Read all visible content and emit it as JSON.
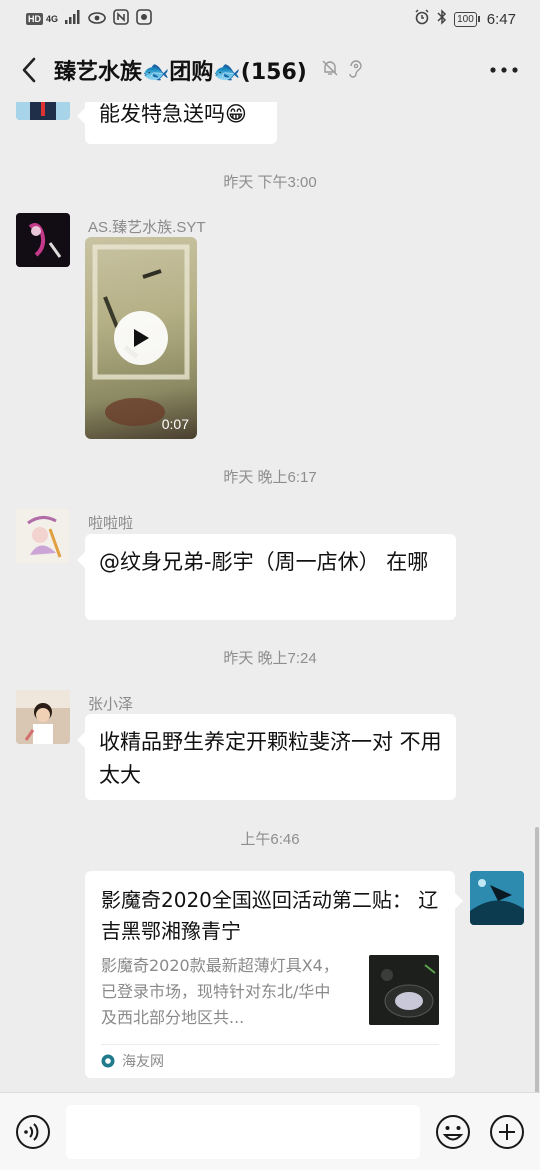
{
  "status_bar": {
    "signal_label": "HD",
    "network": "4G",
    "battery": "100",
    "time": "6:47"
  },
  "header": {
    "title": "臻艺水族🐟团购🐟(156)",
    "back_icon": "chevron-left-icon",
    "more_icon": "more-dots-icon"
  },
  "messages": [
    {
      "type": "text",
      "side": "left",
      "text": "能发特急送吗😁"
    },
    {
      "type": "timestamp",
      "text": "昨天 下午3:00"
    },
    {
      "type": "video",
      "side": "left",
      "sender": "AS.臻艺水族.SYT",
      "duration": "0:07"
    },
    {
      "type": "timestamp",
      "text": "昨天 晚上6:17"
    },
    {
      "type": "text",
      "side": "left",
      "sender": "啦啦啦",
      "text": "@纹身兄弟-彫宇（周一店休） 在哪"
    },
    {
      "type": "timestamp",
      "text": "昨天 晚上7:24"
    },
    {
      "type": "text",
      "side": "left",
      "sender": "张小泽",
      "text": "收精品野生养定开颗粒斐济一对 不用太大"
    },
    {
      "type": "timestamp",
      "text": "上午6:46"
    },
    {
      "type": "link",
      "side": "right",
      "title": "影魔奇2020全国巡回活动第二贴： 辽吉黑鄂湘豫青宁",
      "description": "影魔奇2020款最新超薄灯具X4，已登录市场，现特针对东北/华中及西北部分地区共...",
      "source": "海友网"
    }
  ],
  "input_bar": {
    "placeholder": "",
    "voice_icon": "voice-icon",
    "emoji_icon": "emoji-icon",
    "plus_icon": "plus-icon"
  },
  "colors": {
    "background": "#ededed",
    "bubble": "#ffffff",
    "text": "#111111",
    "meta": "#8e8e8e"
  }
}
